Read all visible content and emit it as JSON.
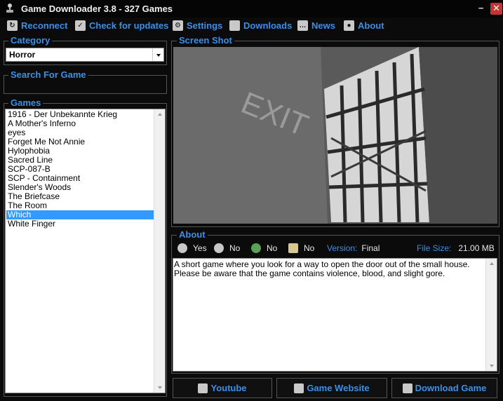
{
  "window": {
    "title": "Game Downloader 3.8 - 327 Games",
    "minimize_icon": "−",
    "close_icon": "✕"
  },
  "toolbar": [
    {
      "label": "Reconnect",
      "icon": "reconnect-icon"
    },
    {
      "label": "Check for updates",
      "icon": "checkmark-icon"
    },
    {
      "label": "Settings",
      "icon": "wrench-icon"
    },
    {
      "label": "Downloads",
      "icon": "folder-icon"
    },
    {
      "label": "News",
      "icon": "chat-bubble-icon"
    },
    {
      "label": "About",
      "icon": "person-icon"
    }
  ],
  "category": {
    "title": "Category",
    "selected": "Horror"
  },
  "search": {
    "title": "Search For Game"
  },
  "games": {
    "title": "Games",
    "items": [
      "1916 - Der Unbekannte Krieg",
      "A Mother's Inferno",
      "eyes",
      "Forget Me Not Annie",
      "Hylophobia",
      "Sacred Line",
      "SCP-087-B",
      "SCP - Containment",
      "Slender's Woods",
      "The Briefcase",
      "The Room",
      "Which",
      "White Finger"
    ],
    "selected_index": 11
  },
  "screenshot": {
    "title": "Screen Shot",
    "sign_text": "EXIT"
  },
  "about": {
    "title": "About",
    "flags": [
      {
        "icon": "single-player-icon",
        "value": "Yes"
      },
      {
        "icon": "multiplayer-icon",
        "value": "No"
      },
      {
        "icon": "globe-icon",
        "value": "No"
      },
      {
        "icon": "id-card-icon",
        "value": "No"
      }
    ],
    "version_label": "Version:",
    "version_value": "Final",
    "filesize_label": "File Size:",
    "filesize_value": "21.00 MB",
    "description": "A short game where you look for a way to open the door out of the small house. Please be aware that the game contains violence, blood, and slight gore."
  },
  "buttons": {
    "youtube": "Youtube",
    "website": "Game Website",
    "download": "Download Game"
  },
  "colors": {
    "accent": "#3d8fe6",
    "selection": "#3399ff",
    "close": "#c83232",
    "background": "#0b0b0b"
  }
}
